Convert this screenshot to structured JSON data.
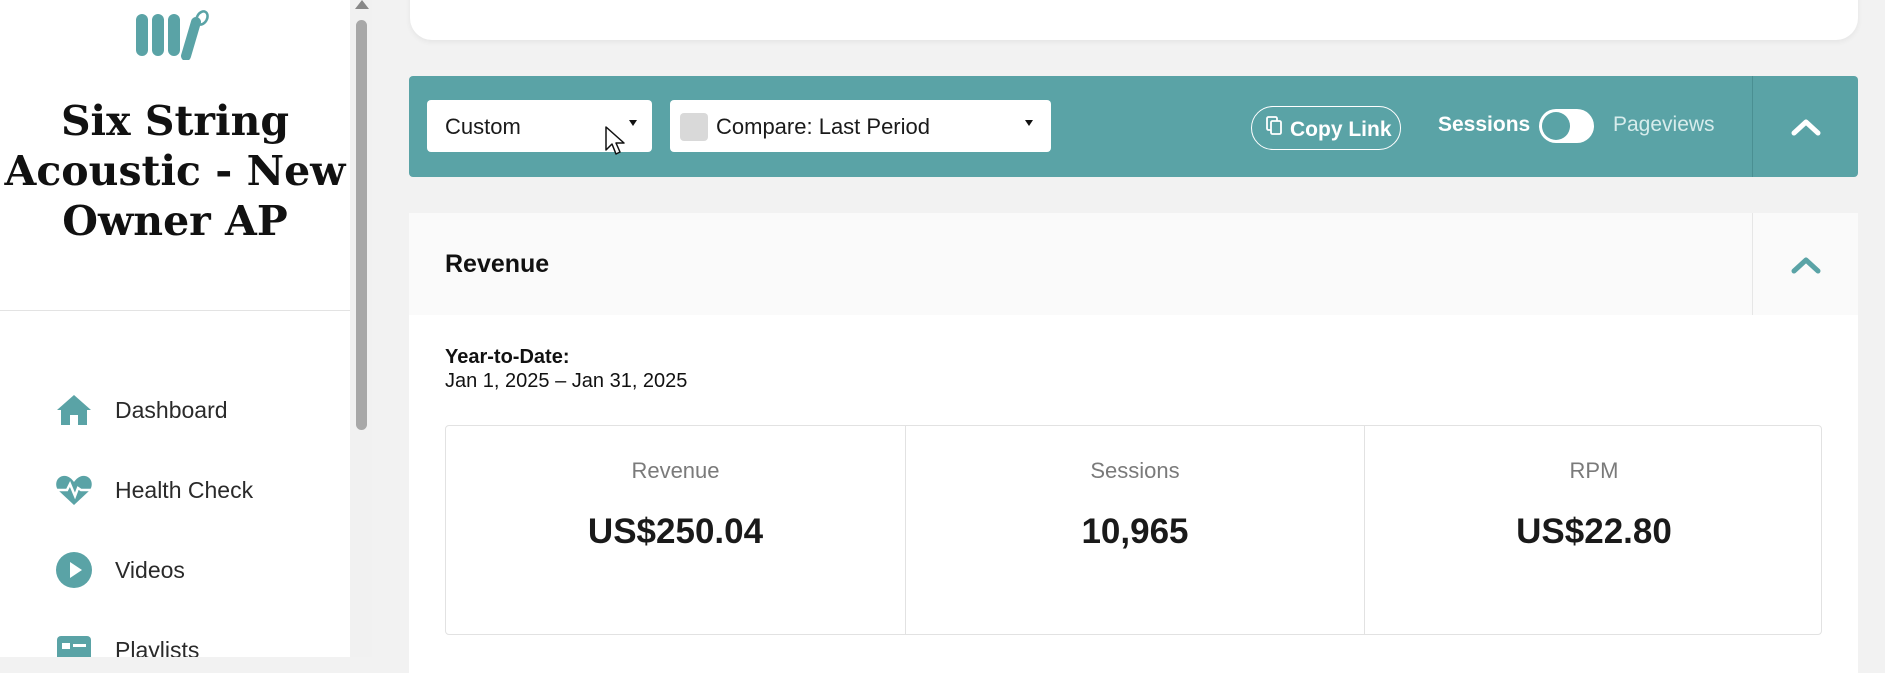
{
  "sidebar": {
    "site_title": "Six String Acoustic - New Owner AP",
    "nav": [
      {
        "label": "Dashboard",
        "icon": "home-icon"
      },
      {
        "label": "Health Check",
        "icon": "heartbeat-icon"
      },
      {
        "label": "Videos",
        "icon": "play-circle-icon"
      },
      {
        "label": "Playlists",
        "icon": "playlist-card-icon"
      }
    ]
  },
  "toolbar": {
    "date_range_select": "Custom",
    "compare_select": "Compare: Last Period",
    "copy_link_label": "Copy Link",
    "toggle_left_label": "Sessions",
    "toggle_right_label": "Pageviews"
  },
  "revenue_panel": {
    "title": "Revenue",
    "period_label": "Year-to-Date:",
    "period_range": "Jan 1, 2025 – Jan 31, 2025",
    "metrics": [
      {
        "label": "Revenue",
        "value": "US$250.04"
      },
      {
        "label": "Sessions",
        "value": "10,965"
      },
      {
        "label": "RPM",
        "value": "US$22.80"
      }
    ]
  },
  "colors": {
    "accent": "#5aa3a6",
    "background": "#f2f2f2"
  }
}
